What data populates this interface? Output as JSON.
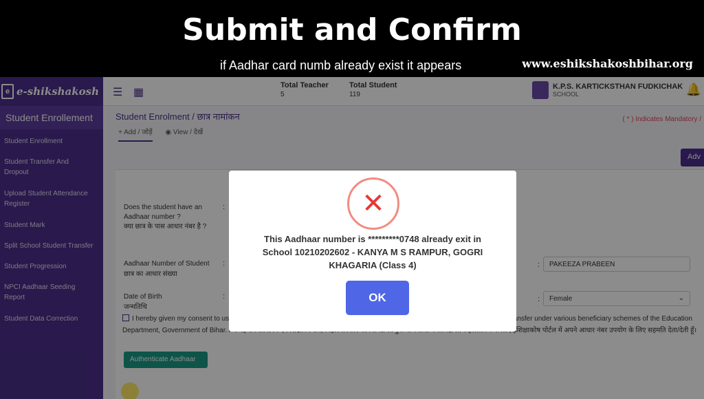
{
  "banner": {
    "title": "Submit and Confirm",
    "subtitle": "if Aadhar card numb already exist it appears",
    "url": "www.eshikshakoshbihar.org"
  },
  "sidebar": {
    "brand": "e-shikshakosh",
    "section": "Student Enrollement",
    "items": [
      {
        "label": "Student Enrollment"
      },
      {
        "label": "Student Transfer And Dropout"
      },
      {
        "label": "Upload Student Attendance Register"
      },
      {
        "label": "Student Mark"
      },
      {
        "label": "Split School Student Transfer"
      },
      {
        "label": "Student Progression"
      },
      {
        "label": "NPCI Aadhaar Seeding Report"
      },
      {
        "label": "Student Data Correction"
      }
    ]
  },
  "topbar": {
    "total_teacher_label": "Total Teacher",
    "total_teacher_value": "5",
    "total_student_label": "Total Student",
    "total_student_value": "119",
    "school_name": "K.P.S. KARTICKSTHAN FUDKICHAK",
    "school_role": "SCHOOL"
  },
  "page": {
    "breadcrumb": "Student Enrolment / छात्र नामांकन",
    "tab_add": "+ Add / जोड़ें",
    "tab_view": "◉ View / देखें",
    "mandatory_note": "( * ) Indicates Mandatory /",
    "adv_button": "Adv"
  },
  "form": {
    "q_aadhaar_label": "Does the student have an Aadhaar number ?",
    "q_aadhaar_hindi": "क्या छात्र के पास आधार नंबर है ?",
    "aadhaar_no_label": "Aadhaar Number of Student",
    "aadhaar_no_hindi": "छात्र का आधार संख्या",
    "dob_label": "Date of Birth",
    "dob_hindi": "जन्मतिथि",
    "name_value": "PAKEEZA PRABEEN",
    "gender_value": "Female",
    "consent_text": "I hereby given my consent to use my Aadhaar number in the eShikshakosh Portal for Identity verification and Direct Benefit Transfer under various beneficiary schemes of the Education Department, Government of Bihar. / मैं पहचान सत्यापन एवं शिक्षा विभाग, बिहार सरकार की विभिन्न लाभुक योजनाओं के प्रत्यक्ष लाभ हस्तांतरण के लिए ईशिक्षाकोष पोर्टल में अपने आधार नंबर उपयोग के लिए सहमति देता/देती हूँ।",
    "auth_button": "Authenticate Aadhaar"
  },
  "modal": {
    "icon": "x-icon",
    "message": "This Aadhaar number is *********0748 already exit in School 10210202602 - KANYA M S RAMPUR, GOGRI KHAGARIA (Class 4)",
    "ok": "OK"
  }
}
